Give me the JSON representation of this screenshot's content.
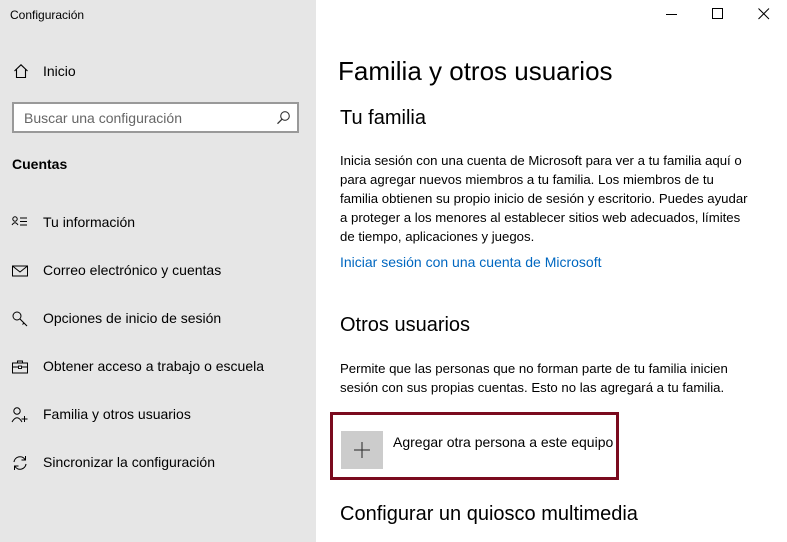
{
  "window": {
    "title": "Configuración"
  },
  "sidebar": {
    "home_label": "Inicio",
    "search_placeholder": "Buscar una configuración",
    "section_label": "Cuentas",
    "items": [
      {
        "label": "Tu información",
        "icon": "user-card-icon"
      },
      {
        "label": "Correo electrónico y cuentas",
        "icon": "mail-icon"
      },
      {
        "label": "Opciones de inicio de sesión",
        "icon": "key-icon"
      },
      {
        "label": "Obtener acceso a trabajo o escuela",
        "icon": "briefcase-icon"
      },
      {
        "label": "Familia y otros usuarios",
        "icon": "person-add-icon"
      },
      {
        "label": "Sincronizar la configuración",
        "icon": "sync-icon"
      }
    ]
  },
  "main": {
    "title": "Familia y otros usuarios",
    "family": {
      "heading": "Tu familia",
      "description_lines": [
        "Inicia sesión con una cuenta de Microsoft para ver a tu familia aquí o",
        "para agregar nuevos miembros a tu familia. Los miembros de tu",
        "familia obtienen su propio inicio de sesión y escritorio. Puedes ayudar",
        "a proteger a los menores al establecer sitios web adecuados, límites",
        "de tiempo, aplicaciones y juegos."
      ],
      "link": "Iniciar sesión con una cuenta de Microsoft"
    },
    "others": {
      "heading": "Otros usuarios",
      "description_lines": [
        "Permite que las personas que no forman parte de tu familia inicien",
        "sesión con sus propias cuentas. Esto no las agregará a tu familia."
      ],
      "add_label": "Agregar otra persona a este equipo"
    },
    "kiosk": {
      "heading": "Configurar un quiosco multimedia"
    }
  },
  "colors": {
    "sidebar_bg": "#e6e6e6",
    "link": "#0067c0",
    "highlight_border": "#7a0a1e"
  }
}
